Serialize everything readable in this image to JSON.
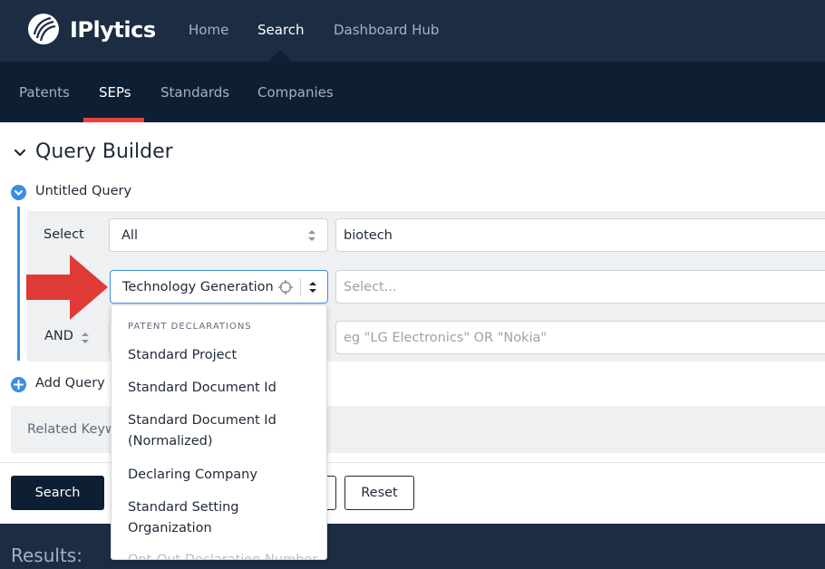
{
  "brand": {
    "name": "IPlytics",
    "logo_icon": "iplytics-logo-icon"
  },
  "top_nav": [
    {
      "label": "Home",
      "active": false
    },
    {
      "label": "Search",
      "active": true
    },
    {
      "label": "Dashboard Hub",
      "active": false
    }
  ],
  "sub_nav": [
    {
      "label": "Patents",
      "active": false
    },
    {
      "label": "SEPs",
      "active": true
    },
    {
      "label": "Standards",
      "active": false
    },
    {
      "label": "Companies",
      "active": false
    }
  ],
  "query_builder": {
    "title": "Query Builder",
    "query_name": "Untitled Query",
    "row1": {
      "label": "Select",
      "field_value": "All",
      "input_value": "biotech"
    },
    "row2": {
      "field_value": "Technology Generation",
      "input_placeholder": "Select..."
    },
    "row3": {
      "operator": "AND",
      "input_placeholder": "eg \"LG Electronics\" OR \"Nokia\""
    },
    "add_query": "Add Query",
    "related_keywords": "Related Keyw"
  },
  "dropdown": {
    "group": "PATENT DECLARATIONS",
    "items": [
      "Standard Project",
      "Standard Document Id",
      "Standard Document Id (Normalized)",
      "Declaring Company",
      "Standard Setting Organization",
      "Opt-Out Declaration Number"
    ]
  },
  "buttons": {
    "search": "Search",
    "reset": "Reset"
  },
  "results": {
    "label": "Results:"
  },
  "colors": {
    "accent": "#3b8de0",
    "brand_dark": "#0f1f33",
    "nav_bg": "#1c2d43",
    "highlight": "#e8423f"
  }
}
